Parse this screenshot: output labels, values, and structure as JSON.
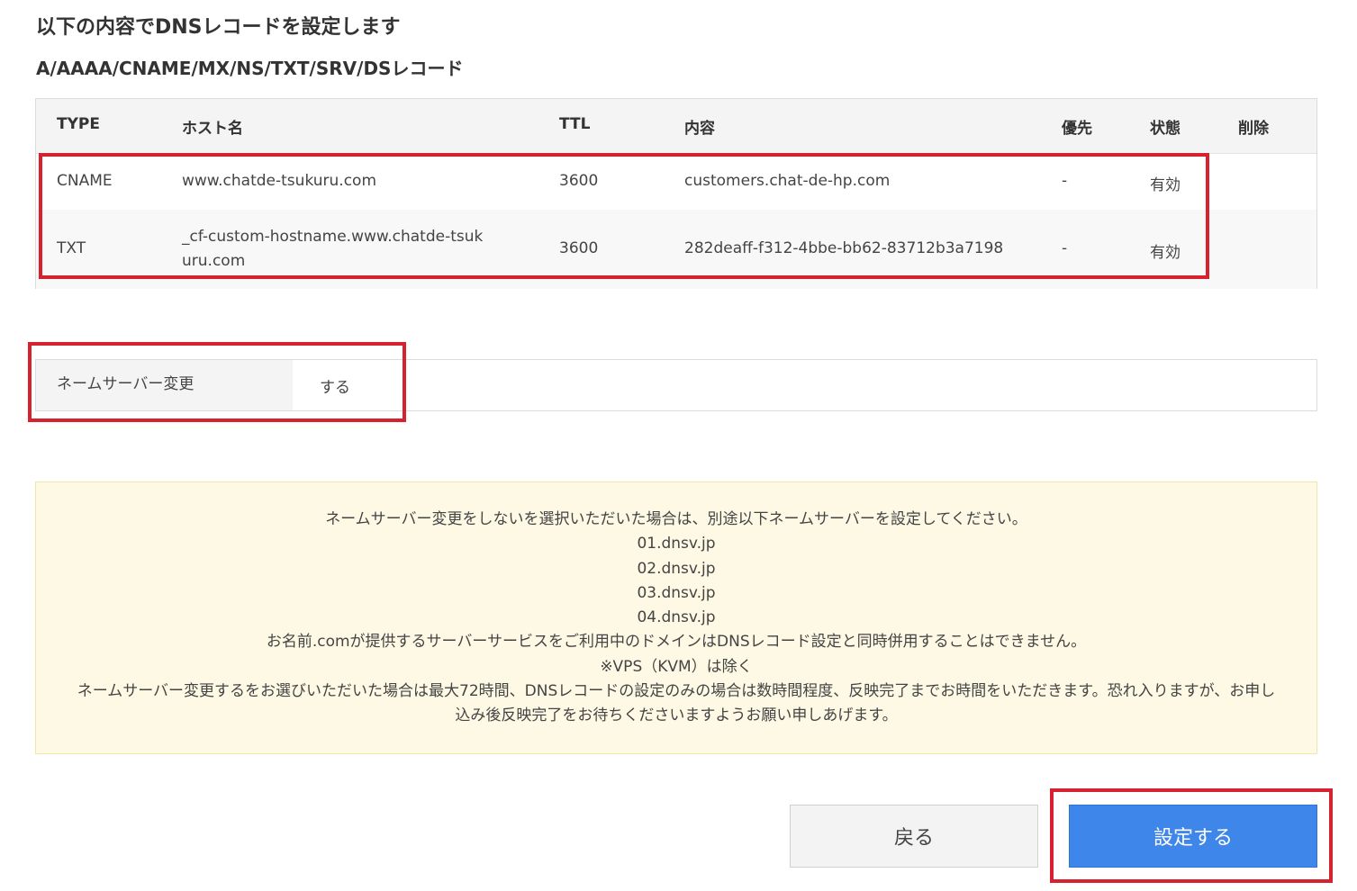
{
  "page": {
    "title": "以下の内容でDNSレコードを設定します",
    "subtitle": "A/AAAA/CNAME/MX/NS/TXT/SRV/DSレコード"
  },
  "table": {
    "headers": {
      "type": "TYPE",
      "host": "ホスト名",
      "ttl": "TTL",
      "content": "内容",
      "priority": "優先",
      "status": "状態",
      "delete": "削除"
    },
    "rows": [
      {
        "type": "CNAME",
        "host": "www.chatde-tsukuru.com",
        "ttl": "3600",
        "content": "customers.chat-de-hp.com",
        "priority": "-",
        "status": "有効"
      },
      {
        "type": "TXT",
        "host": "_cf-custom-hostname.www.chatde-tsukuru.com",
        "ttl": "3600",
        "content": "282deaff-f312-4bbe-bb62-83712b3a7198",
        "priority": "-",
        "status": "有効"
      }
    ]
  },
  "nameserver": {
    "label": "ネームサーバー変更",
    "value": "する"
  },
  "notice": {
    "lines": [
      "ネームサーバー変更をしないを選択いただいた場合は、別途以下ネームサーバーを設定してください。",
      "01.dnsv.jp",
      "02.dnsv.jp",
      "03.dnsv.jp",
      "04.dnsv.jp",
      "お名前.comが提供するサーバーサービスをご利用中のドメインはDNSレコード設定と同時併用することはできません。",
      "※VPS（KVM）は除く",
      "ネームサーバー変更するをお選びいただいた場合は最大72時間、DNSレコードの設定のみの場合は数時間程度、反映完了までお時間をいただきます。恐れ入りますが、お申し込み後反映完了をお待ちくださいますようお願い申しあげます。"
    ]
  },
  "buttons": {
    "back": "戻る",
    "submit": "設定する"
  },
  "colors": {
    "highlight": "#d6212f",
    "primary_button": "#3e86ea",
    "notice_bg": "#fdf9e4"
  }
}
